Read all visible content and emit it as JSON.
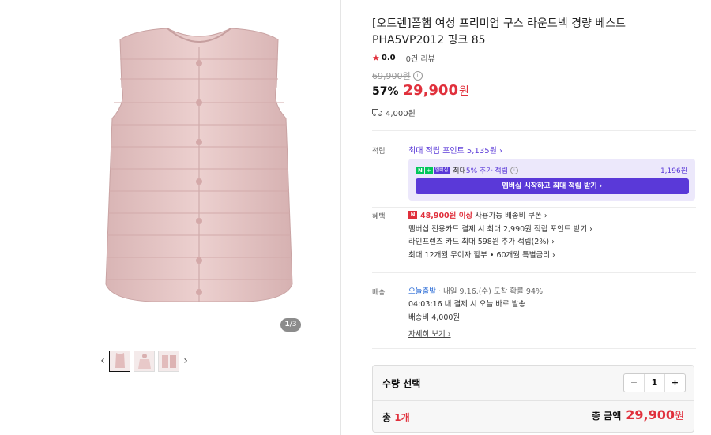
{
  "gallery": {
    "counter_current": "1",
    "counter_total": "/3",
    "prev_icon": "chevron-left-icon",
    "next_icon": "chevron-right-icon"
  },
  "product": {
    "title": "[오트렌]폴햄 여성 프리미엄 구스 라운드넥 경량 베스트 PHA5VP2012 핑크 85",
    "rating": "0.0",
    "reviews": "0건 리뷰",
    "original_price": "69,900원",
    "discount": "57%",
    "price": "29,900",
    "price_unit": "원",
    "shipping_fee": "4,000원"
  },
  "points": {
    "label": "적립",
    "max_points": "최대 적립 포인트 5,135원 ›",
    "membership_badge_n": "N",
    "membership_badge_plus": "+",
    "membership_badge_text": "멤버십",
    "membership_text_prefix": "최대 ",
    "membership_text_hl": "5% 추가 적립",
    "membership_amount": "1,196원",
    "membership_button": "멤버십 시작하고 최대 적립 받기 ›"
  },
  "benefits": {
    "label": "혜택",
    "coupon_badge": "N",
    "coupon_amount": "48,900원 이상",
    "coupon_text": "사용가능 배송비 쿠폰 ›",
    "items": [
      "멤버십 전용카드 결제 시 최대 2,990원 적립 포인트 받기 ›",
      "라인프렌즈 카드 최대 598원 추가 적립(2%) ›",
      "최대 12개월 무이자 할부 • 60개월 특별금리 ›"
    ]
  },
  "delivery": {
    "label": "배송",
    "type": "오늘출발",
    "eta": "· 내일 9.16.(수) 도착 확률 94%",
    "cutoff": "04:03:16  내 결제 시 오늘 바로 발송",
    "fee": "배송비 4,000원",
    "more": "자세히 보기 ›"
  },
  "quantity": {
    "label": "수량 선택",
    "minus": "−",
    "value": "1",
    "plus": "+",
    "total_prefix": "총 ",
    "total_count": "1개",
    "total_label": "총 금액",
    "total_value": "29,900",
    "total_unit": "원"
  },
  "colors": {
    "accent_red": "#e0303c",
    "membership_purple": "#5a39d8",
    "naver_green": "#03c75a",
    "product_pink": "#e6c6c6"
  }
}
